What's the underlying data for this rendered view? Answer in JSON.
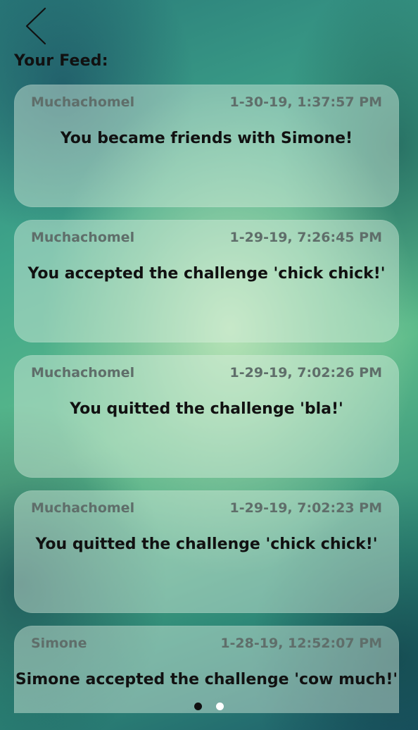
{
  "header": {
    "back_icon": "chevron-left-icon",
    "title": "Your Feed:"
  },
  "feed": [
    {
      "user": "Muchachomel",
      "timestamp": "1-30-19, 1:37:57 PM",
      "message": "You became friends with Simone!"
    },
    {
      "user": "Muchachomel",
      "timestamp": "1-29-19, 7:26:45 PM",
      "message": "You accepted the challenge 'chick chick!'"
    },
    {
      "user": "Muchachomel",
      "timestamp": "1-29-19, 7:02:26 PM",
      "message": "You quitted the challenge 'bla!'"
    },
    {
      "user": "Muchachomel",
      "timestamp": "1-29-19, 7:02:23 PM",
      "message": "You quitted the challenge 'chick chick!'"
    },
    {
      "user": "Simone",
      "timestamp": "1-28-19, 12:52:07 PM",
      "message": "Simone accepted the challenge 'cow much!'"
    }
  ],
  "pagination": {
    "total_pages": 2,
    "current_page": 1
  }
}
